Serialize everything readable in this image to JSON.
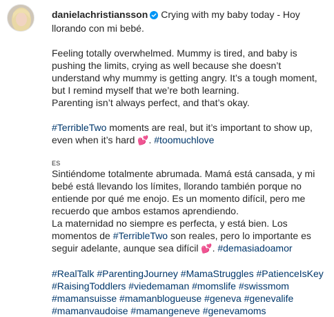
{
  "author": {
    "username": "danielachristiansson",
    "verified": true
  },
  "caption": {
    "title": "Crying with my baby today - Hoy llorando con mi bebé.",
    "en_paragraph": "Feeling totally overwhelmed. Mummy is tired, and baby is pushing the limits, crying as well because she doesn’t understand why mummy is getting angry. It’s a tough moment, but I remind myself that we’re both learning.",
    "en_line2": "Parenting isn’t always perfect, and that’s okay.",
    "en_tag_hashtag": "#TerribleTwo",
    "en_tag_text": " moments are real, but it’s important to show up, even when it’s hard ",
    "en_tag_emoji": "💕",
    "en_tag_sep": ". ",
    "en_tag_hashtag2": "#toomuchlove",
    "lang_label": "ES",
    "es_paragraph": "Sintiéndome totalmente abrumada. Mamá está cansada, y mi bebé está llevando los límites, llorando también porque no entiende por qué me enojo. Es un momento difícil, pero me recuerdo que ambos estamos aprendiendo.",
    "es_line2_pre": "La maternidad no siempre es perfecta, y está bien. Los momentos de ",
    "es_line2_hashtag": "#TerribleTwo",
    "es_line2_post": " son reales, pero lo importante es seguir adelante, aunque sea difícil ",
    "es_emoji": "💕",
    "es_sep": ". ",
    "es_hashtag_end": "#demasiadoamor",
    "hashtags": [
      "#RealTalk",
      "#ParentingJourney",
      "#MamaStruggles",
      "#PatienceIsKey",
      "#RaisingToddlers",
      "#viedemaman",
      "#momslife",
      "#swissmom",
      "#mamansuisse",
      "#mamanblogueuse",
      "#geneva",
      "#genevalife",
      "#mamanvaudoise",
      "#mamangeneve",
      "#genevamoms"
    ]
  },
  "colors": {
    "text": "#262626",
    "hashtag": "#00376b",
    "verified": "#0095f6"
  }
}
